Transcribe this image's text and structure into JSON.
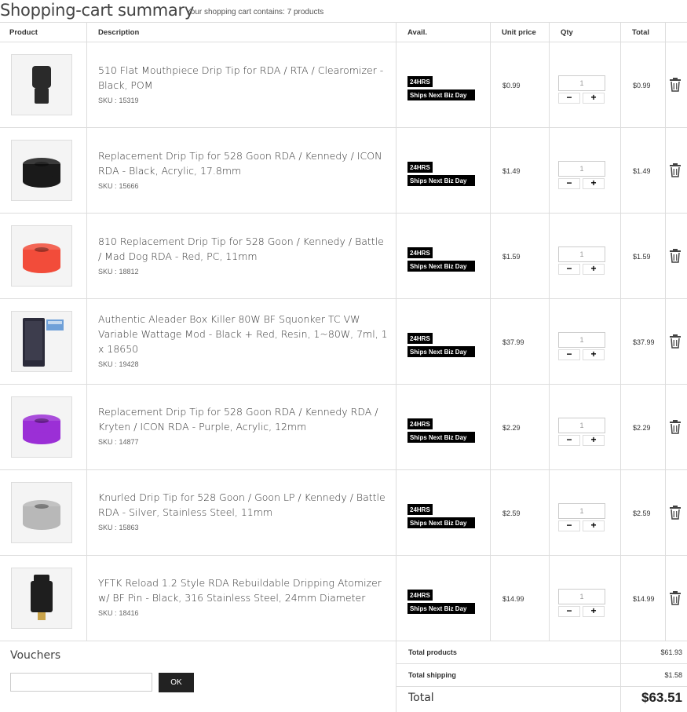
{
  "header": {
    "title": "Shopping-cart summary",
    "cart_count_text": "Your shopping cart contains: 7 products"
  },
  "table": {
    "columns": [
      "Product",
      "Description",
      "Avail.",
      "Unit price",
      "Qty",
      "Total"
    ],
    "sku_label": "SKU :",
    "avail_badge_top": "24HRS",
    "avail_badge_bottom": "Ships Next Biz Day",
    "qty_minus": "−",
    "qty_plus": "+",
    "delete_icon": "trash-icon",
    "items": [
      {
        "name": "510 Flat Mouthpiece Drip Tip for RDA / RTA / Clearomizer - Black, POM",
        "sku": "15319",
        "unit_price": "$0.99",
        "qty": "1",
        "total": "$0.99",
        "thumb_color": "#2a2a2a"
      },
      {
        "name": "Replacement Drip Tip for 528 Goon RDA / Kennedy / ICON RDA - Black, Acrylic, 17.8mm",
        "sku": "15666",
        "unit_price": "$1.49",
        "qty": "1",
        "total": "$1.49",
        "thumb_color": "#1a1a1a"
      },
      {
        "name": "810 Replacement Drip Tip for 528 Goon / Kennedy / Battle / Mad Dog RDA - Red, PC, 11mm",
        "sku": "18812",
        "unit_price": "$1.59",
        "qty": "1",
        "total": "$1.59",
        "thumb_color": "#f24c3a"
      },
      {
        "name": "Authentic Aleader Box Killer 80W BF Squonker TC VW Variable Wattage Mod - Black + Red, Resin, 1~80W, 7ml, 1 x 18650",
        "sku": "19428",
        "unit_price": "$37.99",
        "qty": "1",
        "total": "$37.99",
        "thumb_color": "#2b2b3a"
      },
      {
        "name": "Replacement Drip Tip for 528 Goon RDA / Kennedy RDA / Kryten / ICON RDA - Purple, Acrylic, 12mm",
        "sku": "14877",
        "unit_price": "$2.29",
        "qty": "1",
        "total": "$2.29",
        "thumb_color": "#9b2fd6"
      },
      {
        "name": "Knurled Drip Tip for 528 Goon / Goon LP / Kennedy / Battle RDA - Silver, Stainless Steel, 11mm",
        "sku": "15863",
        "unit_price": "$2.59",
        "qty": "1",
        "total": "$2.59",
        "thumb_color": "#b8b8b8"
      },
      {
        "name": "YFTK Reload 1.2 Style RDA Rebuildable Dripping Atomizer w/ BF Pin - Black, 316 Stainless Steel, 24mm Diameter",
        "sku": "18416",
        "unit_price": "$14.99",
        "qty": "1",
        "total": "$14.99",
        "thumb_color": "#1e1e1e"
      }
    ]
  },
  "vouchers": {
    "title": "Vouchers",
    "input_value": "",
    "ok_label": "OK"
  },
  "summary": {
    "total_products_label": "Total products",
    "total_products_value": "$61.93",
    "total_shipping_label": "Total shipping",
    "total_shipping_value": "$1.58",
    "total_label": "Total",
    "total_value": "$63.51"
  }
}
